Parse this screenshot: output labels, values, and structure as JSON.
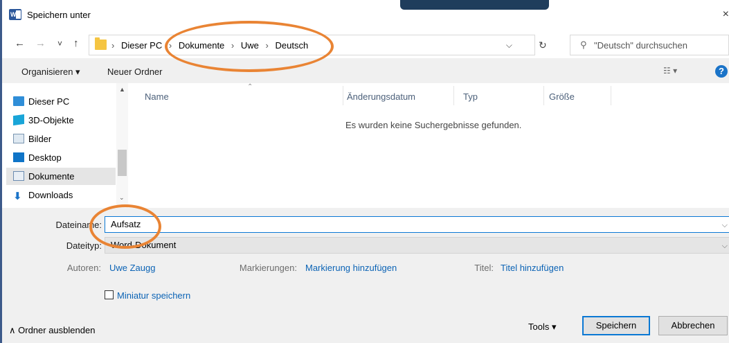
{
  "window": {
    "title": "Speichern unter",
    "app_icon": "word-icon",
    "close_label": "×"
  },
  "nav": {
    "back": "←",
    "forward": "→",
    "recent": "˅",
    "up": "↑",
    "breadcrumb": [
      "Dieser PC",
      "Dokumente",
      "Uwe",
      "Deutsch"
    ],
    "separator": "›",
    "dropdown": "⌵",
    "refresh": "↻",
    "search_placeholder": "\"Deutsch\" durchsuchen"
  },
  "toolbar": {
    "organize": "Organisieren ▾",
    "new_folder": "Neuer Ordner",
    "view": "☷ ▾",
    "help": "?"
  },
  "tree": {
    "items": [
      {
        "label": "Dieser PC",
        "icon": "computer-icon"
      },
      {
        "label": "3D-Objekte",
        "icon": "cube-icon"
      },
      {
        "label": "Bilder",
        "icon": "pictures-icon"
      },
      {
        "label": "Desktop",
        "icon": "desktop-icon"
      },
      {
        "label": "Dokumente",
        "icon": "documents-icon",
        "selected": true
      },
      {
        "label": "Downloads",
        "icon": "download-icon"
      }
    ]
  },
  "content": {
    "columns": [
      "Name",
      "Änderungsdatum",
      "Typ",
      "Größe"
    ],
    "empty_message": "Es wurden keine Suchergebnisse gefunden."
  },
  "form": {
    "filename_label": "Dateiname:",
    "filename_value": "Aufsatz",
    "filetype_label": "Dateityp:",
    "filetype_value": "Word-Dokument",
    "authors_label": "Autoren:",
    "authors_value": "Uwe Zaugg",
    "tags_label": "Markierungen:",
    "tags_value": "Markierung hinzufügen",
    "title_label": "Titel:",
    "title_value": "Titel hinzufügen",
    "thumbnail_label": "Miniatur speichern"
  },
  "footer": {
    "hide_folders": "∧  Ordner ausblenden",
    "tools": "Tools  ▾",
    "save": "Speichern",
    "cancel": "Abbrechen"
  },
  "colors": {
    "annotation": "#e98434",
    "accent": "#0a78d4"
  }
}
